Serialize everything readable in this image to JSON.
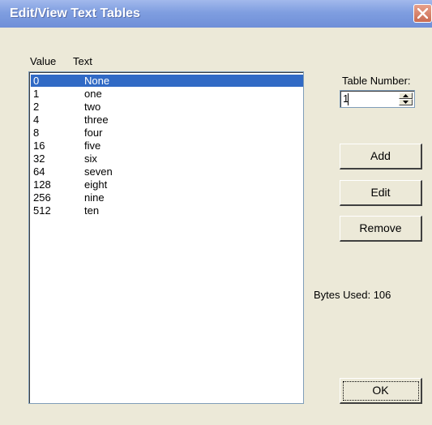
{
  "window": {
    "title": "Edit/View Text Tables"
  },
  "list": {
    "header_value": "Value",
    "header_text": "Text",
    "items": [
      {
        "value": "0",
        "text": "None"
      },
      {
        "value": "1",
        "text": "one"
      },
      {
        "value": "2",
        "text": "two"
      },
      {
        "value": "4",
        "text": "three"
      },
      {
        "value": "8",
        "text": "four"
      },
      {
        "value": "16",
        "text": "five"
      },
      {
        "value": "32",
        "text": "six"
      },
      {
        "value": "64",
        "text": "seven"
      },
      {
        "value": "128",
        "text": "eight"
      },
      {
        "value": "256",
        "text": "nine"
      },
      {
        "value": "512",
        "text": "ten"
      }
    ],
    "selected_index": 0
  },
  "table_number": {
    "label": "Table Number:",
    "value": "1"
  },
  "buttons": {
    "add": "Add",
    "edit": "Edit",
    "remove": "Remove",
    "ok": "OK"
  },
  "bytes_used": "Bytes Used: 106",
  "colors": {
    "titlebar": "#7f9ee0",
    "selection": "#316ac5",
    "dialog_bg": "#ece9d8",
    "close": "#c96b52"
  },
  "icons": {
    "close": "close-icon",
    "spin_up": "spin-up-arrow-icon",
    "spin_down": "spin-down-arrow-icon"
  }
}
